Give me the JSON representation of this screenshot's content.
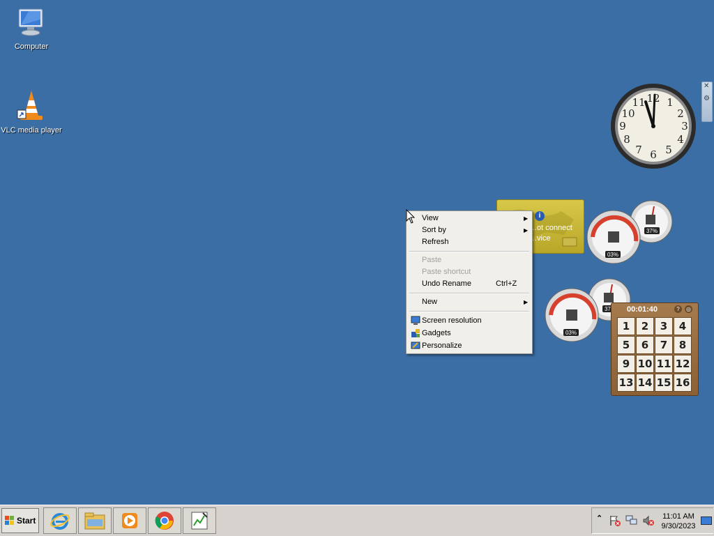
{
  "desktop": {
    "icons": [
      {
        "label": "Computer"
      },
      {
        "label": "VLC media player"
      }
    ]
  },
  "weather": {
    "message": "…ot connect\n…vice"
  },
  "gauges": {
    "cpu_label_1": "03%",
    "mem_label_1": "37%",
    "cpu_label_2": "03%",
    "mem_label_2": "37%"
  },
  "puzzle": {
    "timer": "00:01:40",
    "tiles": [
      "1",
      "2",
      "3",
      "4",
      "5",
      "6",
      "7",
      "8",
      "9",
      "10",
      "11",
      "12",
      "13",
      "14",
      "15",
      "16"
    ]
  },
  "context_menu": {
    "view": "View",
    "sort_by": "Sort by",
    "refresh": "Refresh",
    "paste": "Paste",
    "paste_shortcut": "Paste shortcut",
    "undo_rename": "Undo Rename",
    "undo_rename_shortcut": "Ctrl+Z",
    "new": "New",
    "screen_resolution": "Screen resolution",
    "gadgets": "Gadgets",
    "personalize": "Personalize"
  },
  "taskbar": {
    "start_label": "Start",
    "pinned": [
      "internet-explorer-icon",
      "file-explorer-icon",
      "media-player-icon",
      "chrome-icon",
      "app-icon"
    ],
    "tray": {
      "time": "11:01 AM",
      "date": "9/30/2023"
    }
  },
  "colors": {
    "desktop": "#3a6ea5",
    "taskbar": "#d6d3ce"
  }
}
